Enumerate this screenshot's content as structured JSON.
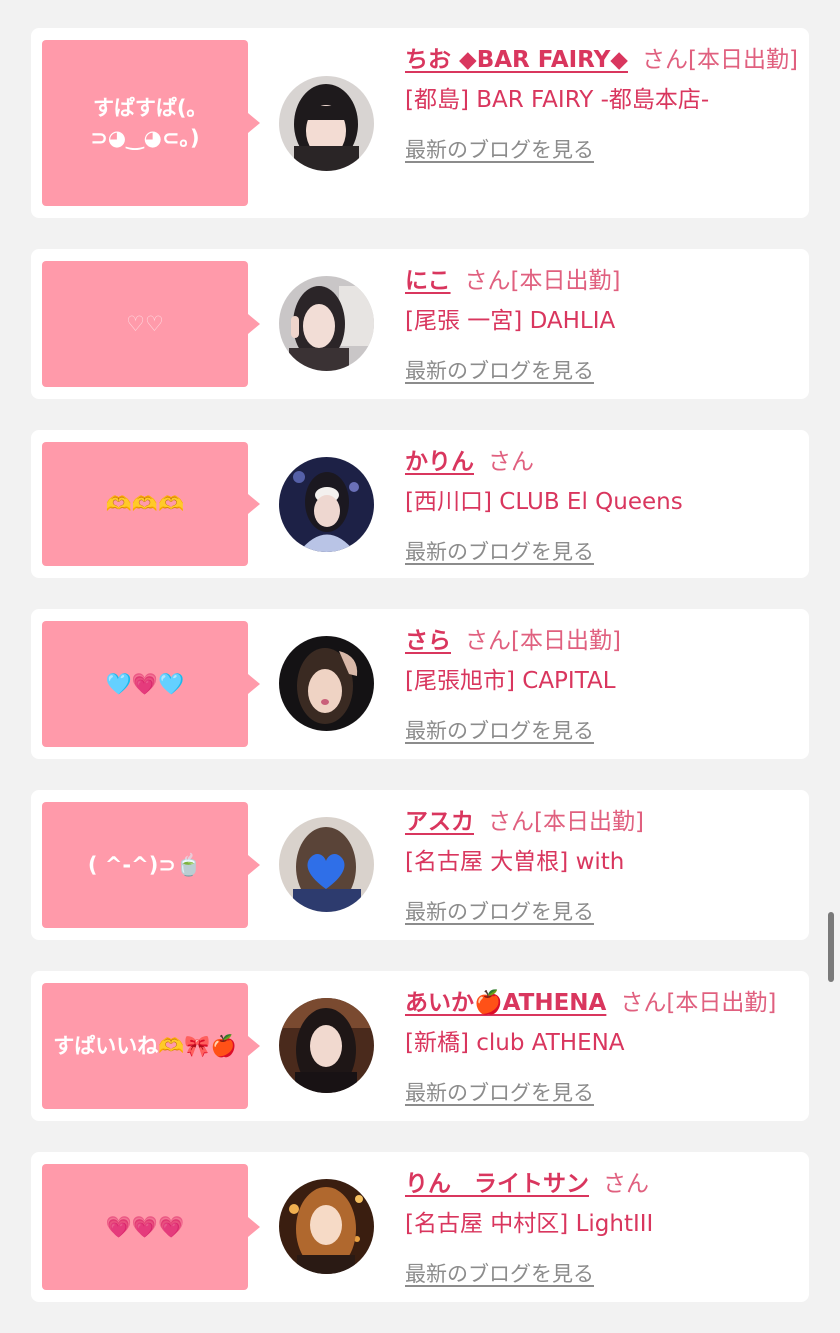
{
  "colors": {
    "page_bg": "#f2f2f2",
    "card_bg": "#ffffff",
    "bubble_bg": "#ff9aaa",
    "name_color": "#d9365e",
    "link_gray": "#8c8c8c"
  },
  "cards": [
    {
      "message": "すぱすぱ(｡⊃◕‿◕⊂｡)",
      "name": "ちお ◆BAR FAIRY◆",
      "status": "さん[本日出勤]",
      "shop": "[都島] BAR FAIRY -都島本店-",
      "link": "最新のブログを見る",
      "avatar": "woman-portrait-dark-hair"
    },
    {
      "message": "♡♡",
      "name": "にこ",
      "status": "さん[本日出勤]",
      "shop": "[尾張 一宮] DAHLIA",
      "link": "最新のブログを見る",
      "avatar": "woman-peace-sign"
    },
    {
      "message": "🫶🫶🫶",
      "name": "かりん",
      "status": "さん",
      "shop": "[西川口] CLUB El Queens",
      "link": "最新のブログを見る",
      "avatar": "woman-blue-dress-masked"
    },
    {
      "message": "🩵💗🩵",
      "name": "さら",
      "status": "さん[本日出勤]",
      "shop": "[尾張旭市] CAPITAL",
      "link": "最新のブログを見る",
      "avatar": "woman-dark-background"
    },
    {
      "message": "( ^-^)⊃🍵",
      "name": "アスカ",
      "status": "さん[本日出勤]",
      "shop": "[名古屋 大曽根] with",
      "link": "最新のブログを見る",
      "avatar": "woman-blue-heart-face"
    },
    {
      "message": "すぱいいね🫶🎀🍎",
      "name": "あいか🍎ATHENA",
      "status": "さん[本日出勤]",
      "shop": "[新橋] club ATHENA",
      "link": "最新のブログを見る",
      "avatar": "woman-long-hair"
    },
    {
      "message": "💗💗💗",
      "name": "りん　ライトサン",
      "status": "さん",
      "shop": "[名古屋 中村区] LightIII",
      "link": "最新のブログを見る",
      "avatar": "woman-illustrated"
    }
  ]
}
